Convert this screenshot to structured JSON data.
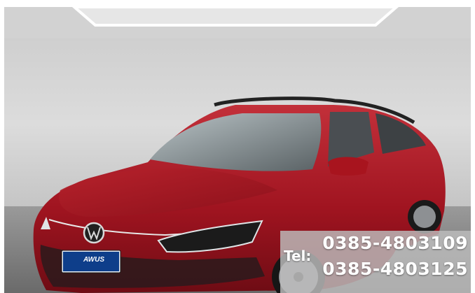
{
  "photo": {
    "subject_icon": "car-photo",
    "colors": {
      "body": "#a4141c",
      "wall": "#d6d6d6",
      "floor": "#7d7d7d",
      "ceiling": "#cfcfcf",
      "overlay": "#bdbdbd"
    }
  },
  "dealer_plate": {
    "brand": "AWUS"
  },
  "contact": {
    "tel_label": "Tel:",
    "phone_1": "0385-4803109",
    "phone_2": "0385-4803125"
  }
}
